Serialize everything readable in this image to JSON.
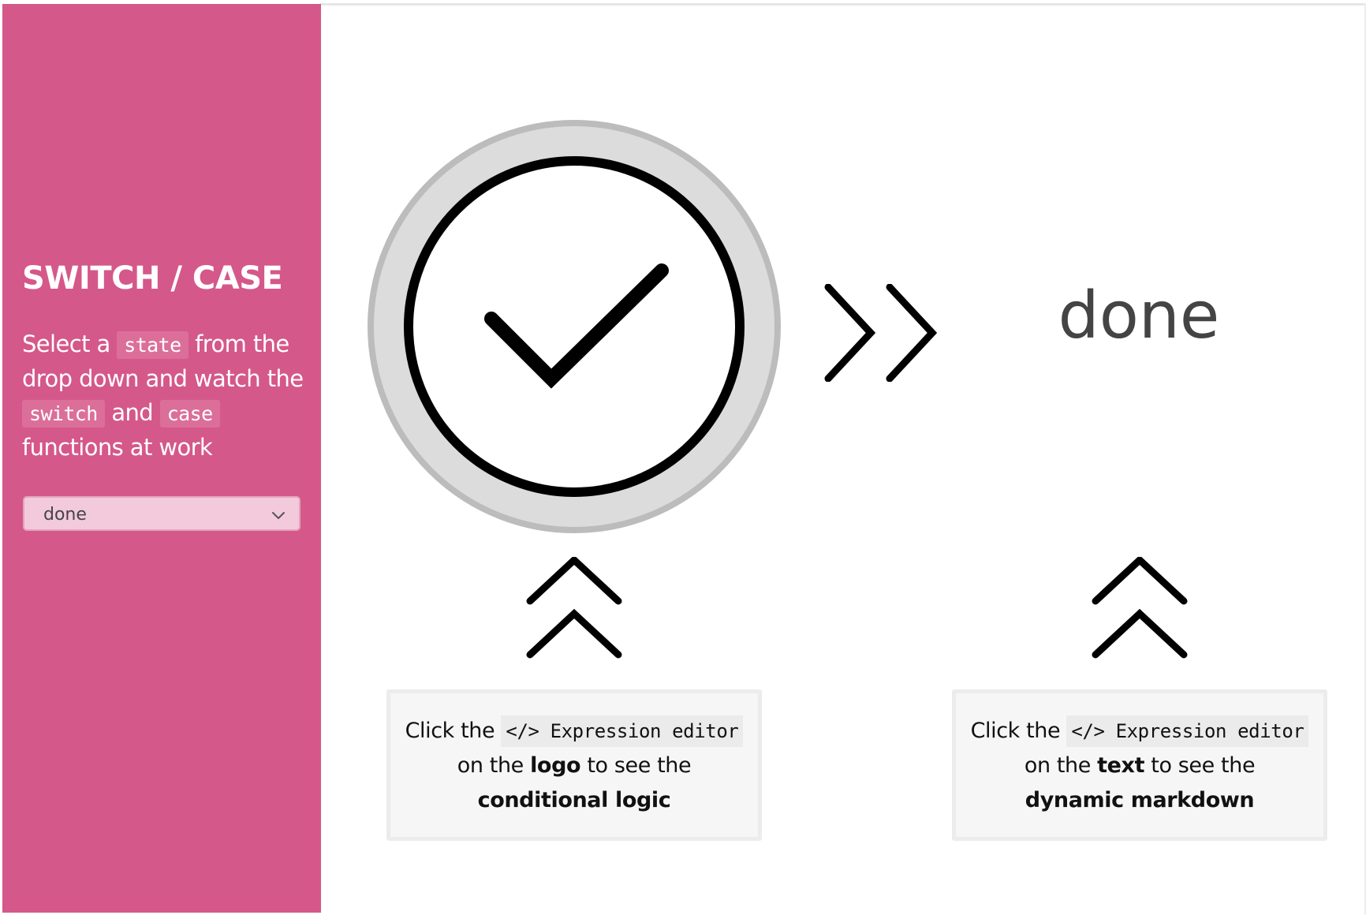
{
  "sidebar": {
    "title": "SWITCH / CASE",
    "desc_part1": "Select a",
    "code_state": "state",
    "desc_part2": "from the drop down and watch the",
    "code_switch": "switch",
    "desc_and": "and",
    "code_case": "case",
    "desc_part3": "functions at work",
    "bg_color": "#d5588a"
  },
  "state_select": {
    "selected": "done"
  },
  "logo": {
    "icon": "checkmark-icon"
  },
  "display": {
    "state_text": "done"
  },
  "hints": {
    "left": {
      "prefix": "Click the",
      "code": "</> Expression editor",
      "middle_pre": "on the",
      "bold_target": "logo",
      "middle_post": "to see the",
      "bold_end": "conditional logic"
    },
    "right": {
      "prefix": "Click the",
      "code": "</> Expression editor",
      "middle_pre": "on the",
      "bold_target": "text",
      "middle_post": "to see the",
      "bold_end": "dynamic markdown"
    }
  }
}
